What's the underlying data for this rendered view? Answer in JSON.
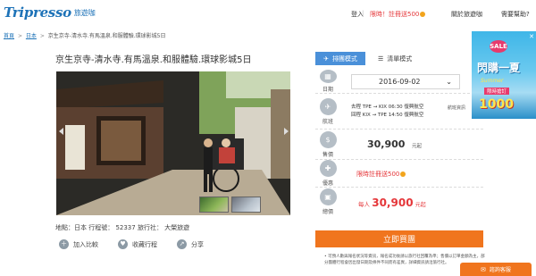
{
  "header": {
    "logo_text": "Tripresso",
    "logo_cn": "旅遊咖",
    "login": "登入",
    "separator": "|",
    "promo": "限時！註冊送500",
    "about": "關於旅遊咖",
    "help": "需要幫助?"
  },
  "breadcrumb": {
    "home": "首頁",
    "country": "日本",
    "current": "京生京寺-清水寺.有馬溫泉.和服體驗.環球影城5日",
    "sep": ">"
  },
  "title": "京生京寺-清水寺.有馬溫泉.和服體驗.環球影城5日",
  "meta": {
    "text": "地點：日本  行程號： 52337  旅行社： 大榮旅遊"
  },
  "actions": {
    "compare": "加入比較",
    "favorite": "收藏行程",
    "share": "分享"
  },
  "panel": {
    "tab_schedule": "排團模式",
    "tab_list": "清單模式",
    "date_label": "日期",
    "date_value": "2016-09-02",
    "flight_label": "航班",
    "flight_out": "去程 TPE → KIX 06:30 復興航空",
    "flight_back": "回程 KIX → TPE 14:50 復興航空",
    "flight_note": "航班資訊",
    "price_label": "售價",
    "price_value": "30,900",
    "price_unit": "元起",
    "offer_label": "優惠",
    "offer_text": "限時註冊送500",
    "total_label": "總價",
    "total_pre": "每人",
    "total_value": "30,900",
    "total_post": "元起"
  },
  "buy_button": "立即買團",
  "notes": "• 可預人數與報名狀況等資訊，報名成功後請以旅行社回覆為準；售價以訂單金額為主，部分團體行程會因出發日期及條件不同而有差異，詳細資訊請洽旅行社。",
  "ad": {
    "sale": "SALE",
    "title": "閃購一夏",
    "subtitle": "Summer",
    "tag": "限時搶訂",
    "amount": "1000"
  },
  "chat_button": "諮詢客服",
  "colors": {
    "brand_blue": "#1e73b8",
    "tab_blue": "#4a90d9",
    "promo_red": "#e5373a",
    "buy_orange": "#f0751e"
  }
}
